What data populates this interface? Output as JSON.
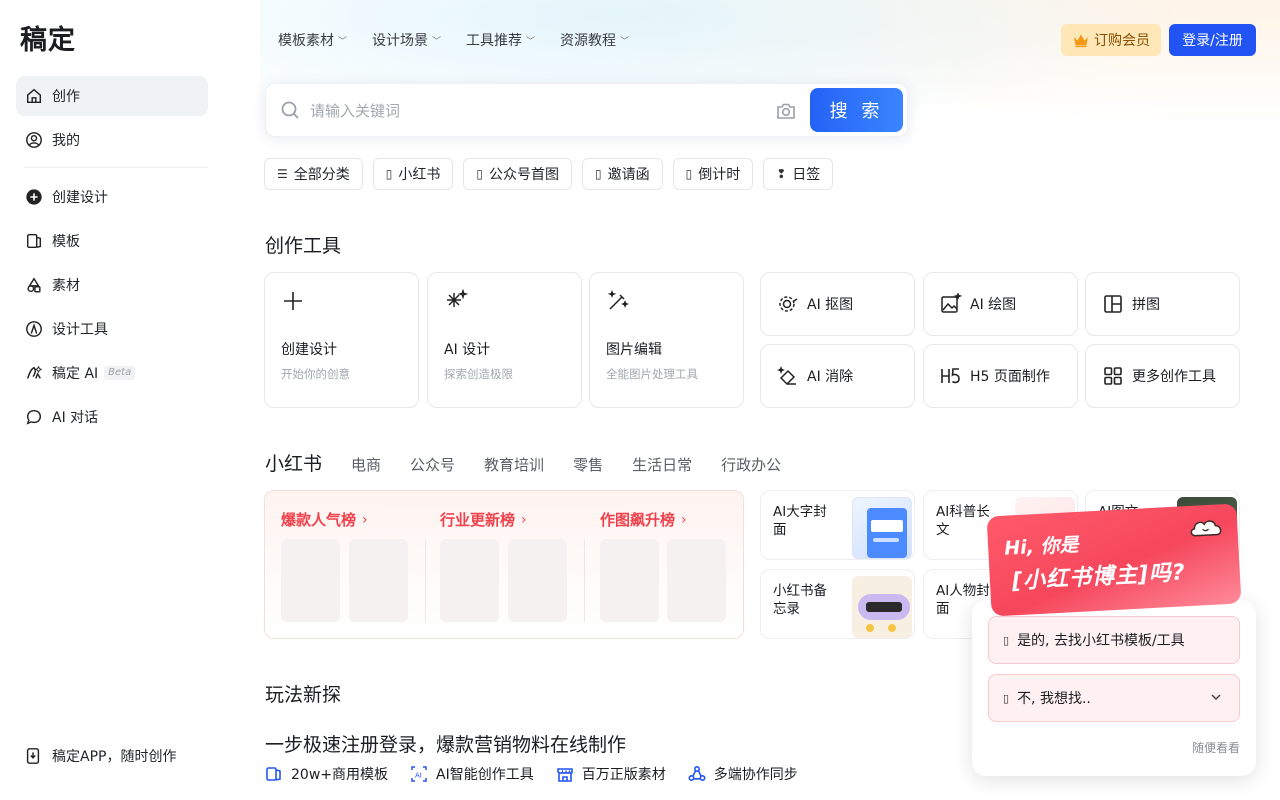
{
  "brand": {
    "logo": "稿定"
  },
  "sidebar": {
    "items": [
      {
        "label": "创作"
      },
      {
        "label": "我的"
      },
      {
        "label": "创建设计"
      },
      {
        "label": "模板"
      },
      {
        "label": "素材"
      },
      {
        "label": "设计工具"
      },
      {
        "label": "稿定 AI",
        "badge": "Beta"
      },
      {
        "label": "AI 对话"
      }
    ],
    "app_link": "稿定APP，随时创作"
  },
  "topnav": {
    "items": [
      "模板素材",
      "设计场景",
      "工具推荐",
      "资源教程"
    ],
    "vip_label": "订购会员",
    "login_label": "登录/注册"
  },
  "search": {
    "placeholder": "请输入关键词",
    "button_label": "搜 索"
  },
  "chips": [
    "全部分类",
    "小红书",
    "公众号首图",
    "邀请函",
    "倒计时",
    "日签"
  ],
  "creation_tools": {
    "title": "创作工具",
    "big": [
      {
        "title": "创建设计",
        "sub": "开始你的创意"
      },
      {
        "title": "AI 设计",
        "sub": "探索创造极限"
      },
      {
        "title": "图片编辑",
        "sub": "全能图片处理工具"
      }
    ],
    "small": [
      "AI 抠图",
      "AI 绘图",
      "拼图",
      "AI 消除",
      "H5 页面制作",
      "更多创作工具"
    ]
  },
  "categories": {
    "tabs": [
      "小红书",
      "电商",
      "公众号",
      "教育培训",
      "零售",
      "生活日常",
      "行政办公"
    ],
    "rankings": [
      "爆款人气榜",
      "行业更新榜",
      "作图飙升榜"
    ],
    "templates": [
      "AI大字封面",
      "AI科普长文",
      "AI图文",
      "小红书备忘录",
      "AI人物封面"
    ]
  },
  "explore": {
    "title": "玩法新探",
    "promo_title": "一步极速注册登录，爆款营销物料在线制作",
    "features": [
      "20w+商用模板",
      "AI智能创作工具",
      "百万正版素材",
      "多端协作同步"
    ]
  },
  "popup": {
    "banner_hi": "Hi, 你是",
    "banner_question": "[小红书博主]吗?",
    "option_yes": "是的, 去找小红书模板/工具",
    "option_no": "不, 我想找..",
    "skip_label": "随便看看"
  },
  "colors": {
    "accent": "#2254f4",
    "rank_red": "#f0424d",
    "vip_bg": "#ffe7b8"
  }
}
